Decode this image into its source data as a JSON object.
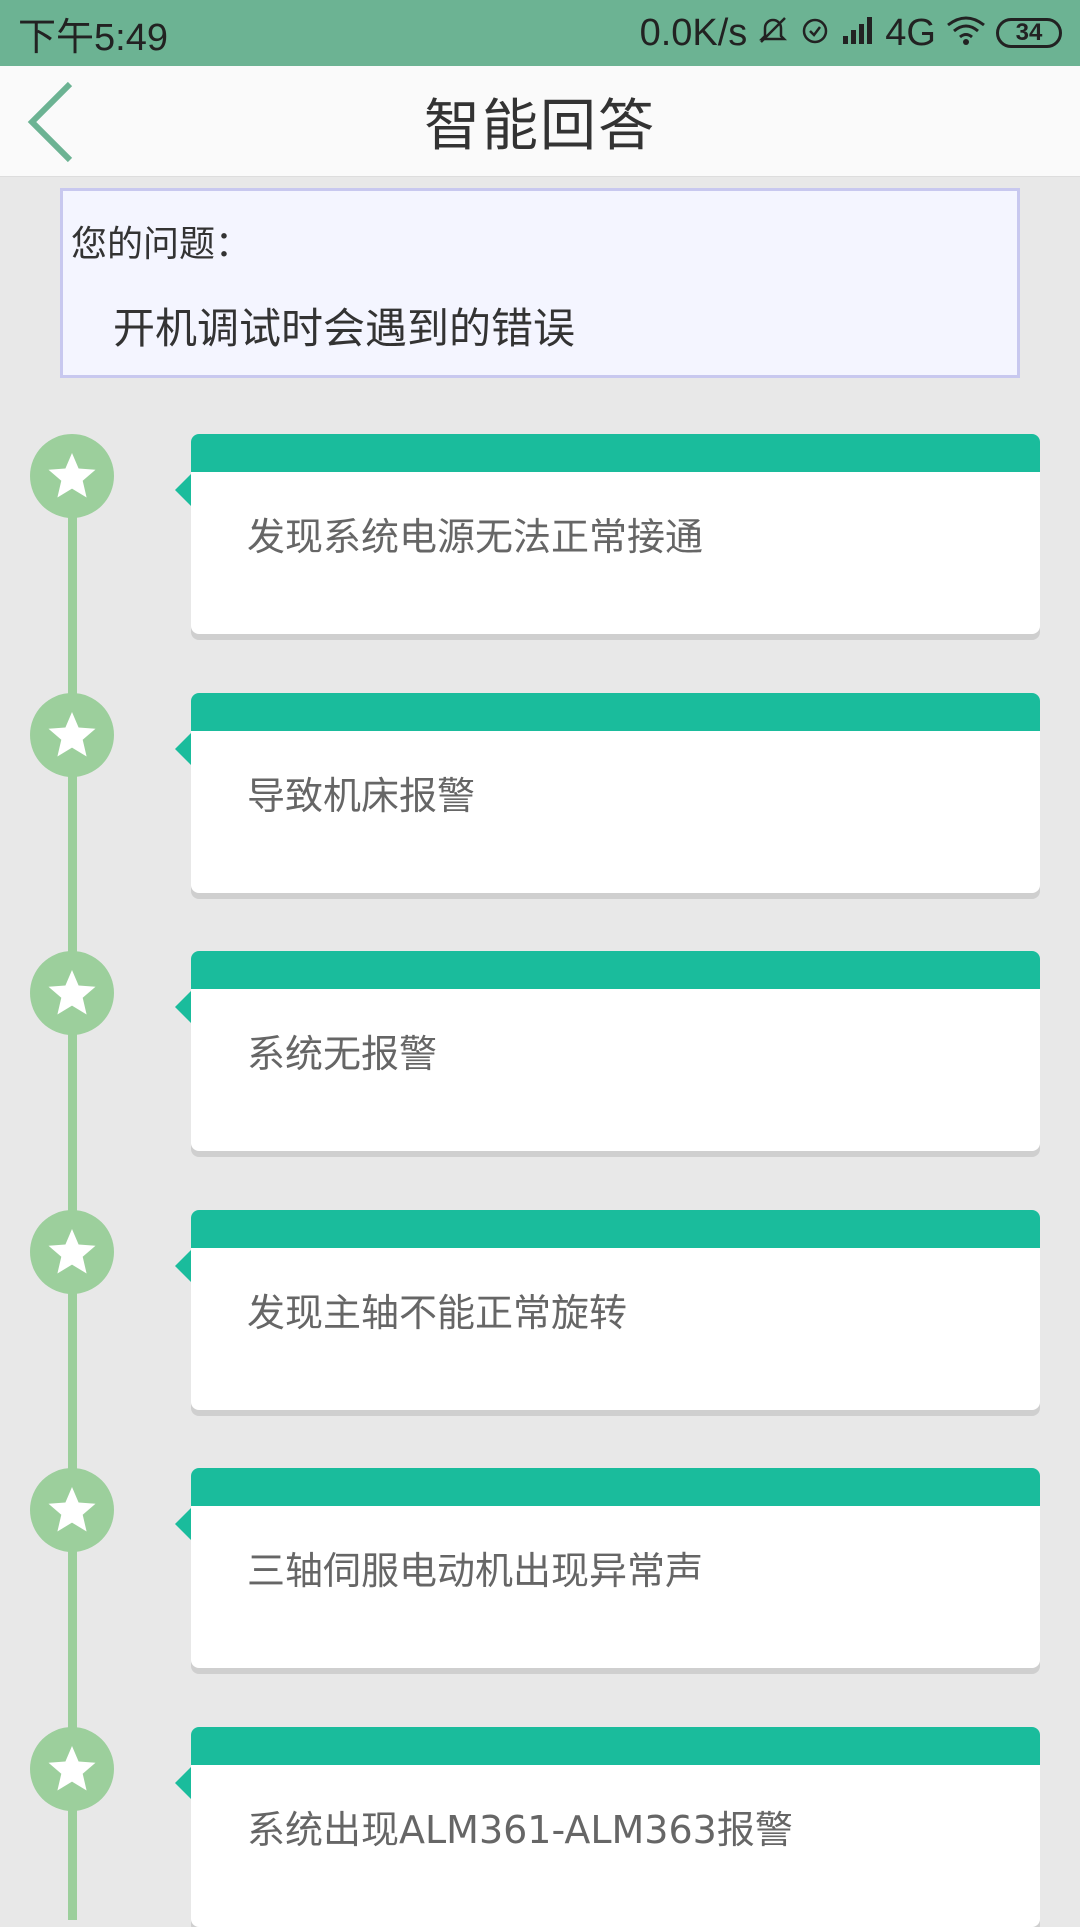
{
  "status_bar": {
    "time": "下午5:49",
    "network_speed": "0.0K/s",
    "network_type": "4G",
    "battery": "34",
    "icons": [
      "mute-bell-icon",
      "alarm-icon",
      "signal-icon",
      "wifi-icon",
      "battery-icon"
    ]
  },
  "app_bar": {
    "title": "智能回答",
    "back_icon": "chevron-left-icon"
  },
  "question": {
    "label": "您的问题：",
    "text": "开机调试时会遇到的错误"
  },
  "colors": {
    "status_bar_bg": "#6cb393",
    "card_header": "#1abc9c",
    "timeline": "#9ccf9c",
    "background": "#e8e8e8"
  },
  "answers": [
    {
      "text": "发现系统电源无法正常接通",
      "icon": "star-icon"
    },
    {
      "text": "导致机床报警",
      "icon": "star-icon"
    },
    {
      "text": "系统无报警",
      "icon": "star-icon"
    },
    {
      "text": "发现主轴不能正常旋转",
      "icon": "star-icon"
    },
    {
      "text": "三轴伺服电动机出现异常声",
      "icon": "star-icon"
    },
    {
      "text": "系统出现ALM361-ALM363报警",
      "icon": "star-icon"
    }
  ]
}
